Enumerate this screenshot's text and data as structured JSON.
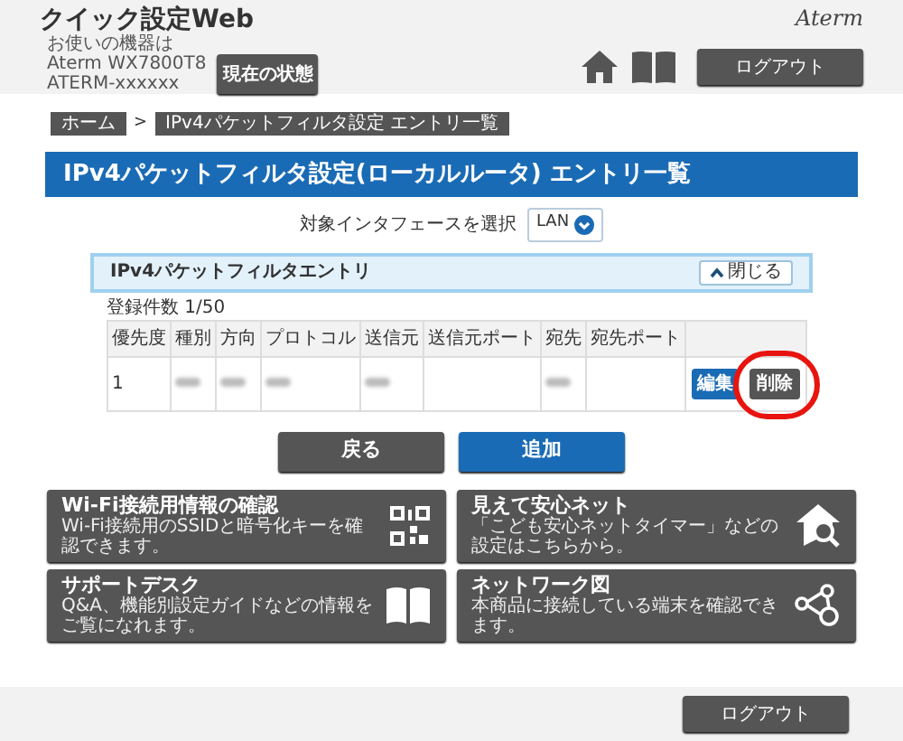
{
  "header": {
    "title": "クイック設定Web",
    "device_lines": [
      "お使いの機器は",
      "Aterm WX7800T8",
      "ATERM-xxxxxx"
    ],
    "status_button": "現在の状態",
    "brand": "Aterm",
    "logout": "ログアウト"
  },
  "breadcrumb": [
    "ホーム",
    "IPv4パケットフィルタ設定 エントリ一覧"
  ],
  "breadcrumb_separator": ">",
  "page_title": "IPv4パケットフィルタ設定(ローカルルータ) エントリ一覧",
  "interface_select": {
    "label": "対象インタフェースを選択",
    "value": "LAN"
  },
  "section": {
    "title": "IPv4パケットフィルタエントリ",
    "toggle": "閉じる",
    "expanded": true
  },
  "count": "登録件数 1/50",
  "table": {
    "columns": [
      "優先度",
      "種別",
      "方向",
      "プロトコル",
      "送信元",
      "送信元ポート",
      "宛先",
      "宛先ポート"
    ],
    "rows": [
      {
        "cells": [
          {
            "kind": "text",
            "text": "1"
          },
          {
            "kind": "blurred"
          },
          {
            "kind": "blurred"
          },
          {
            "kind": "blurred"
          },
          {
            "kind": "blurred"
          },
          {
            "kind": "empty"
          },
          {
            "kind": "blurred"
          },
          {
            "kind": "empty"
          }
        ],
        "edit": "編集",
        "delete": {
          "label": "削除",
          "highlighted": true
        }
      }
    ]
  },
  "actions": [
    {
      "label": "戻る",
      "kind": "secondary"
    },
    {
      "label": "追加",
      "kind": "primary"
    }
  ],
  "cards": [
    {
      "title": "Wi-Fi接続用情報の確認",
      "desc": "Wi-Fi接続用のSSIDと暗号化キーを確認できます。",
      "kind": "qr"
    },
    {
      "title": "見えて安心ネット",
      "desc": "「こども安心ネットタイマー」などの設定はこちらから。",
      "kind": "house"
    },
    {
      "title": "サポートデスク",
      "desc": "Q&A、機能別設定ガイドなどの情報をご覧になれます。",
      "kind": "book"
    },
    {
      "title": "ネットワーク図",
      "desc": "本商品に接続している端末を確認できます。",
      "kind": "network"
    }
  ],
  "footer": {
    "logout": "ログアウト"
  }
}
